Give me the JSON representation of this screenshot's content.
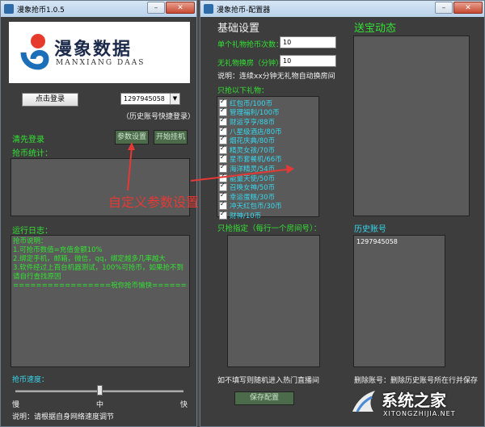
{
  "left": {
    "title": "漫象抢币1.0.5",
    "logo": {
      "brand": "漫象数据",
      "sub": "MANXIANG DAAS"
    },
    "login_button": "点击登录",
    "account_select": "1297945058",
    "history_hint": "（历史账号快捷登录）",
    "login_status": "清先登录",
    "config_button": "参数设置",
    "start_button": "开始挂机",
    "stats_label": "抢币统计：",
    "annotation": "自定义参数设置",
    "log_label": "运行日志：",
    "log_lines": [
      "抢币说明：",
      "1.可抢币数值=充值金额10%",
      "2.绑定手机，邮箱，微信，qq，绑定越多几率越大",
      "3.软件经过上百台机器测试，100%可抢币，如果抢不到请自行查找原因",
      "=================祝你抢币愉快================"
    ],
    "speed_label": "抢币速度：",
    "speed_slow": "慢",
    "speed_mid": "中",
    "speed_fast": "快",
    "speed_value": 0.5,
    "speed_note": "说明：请根据自身网络速度调节"
  },
  "right": {
    "title": "漫象抢币-配置器",
    "basic_title": "基础设置",
    "count_label": "单个礼物抢币次数：",
    "count_value": "10",
    "switch_label": "无礼物换房（分钟）：",
    "switch_value": "10",
    "switch_note": "说明：连续xx分钟无礼物自动换房间",
    "gifts_label": "只抢以下礼物：",
    "gifts": [
      "红包币/100币",
      "管理福利/100币",
      "财运亨亨/88币",
      "八星级酒店/80币",
      "烟花庆典/80币",
      "精灵女孩/70币",
      "星币套餐机/66币",
      "海洋精灵/54币",
      "能量天使/50币",
      "召唤女神/50币",
      "幸运蛋糕/30币",
      "冲天红包币/30币",
      "财神/10币"
    ],
    "rooms_label": "只抢指定（每行一个房间号）：",
    "rooms_note": "如不填写则随机进入热门直播间",
    "save_button": "保存配置",
    "dynamics_title": "送宝动态",
    "history_title": "历史账号",
    "history_items": [
      "1297945058"
    ],
    "history_note": "删除账号：删除历史账号所在行并保存"
  },
  "watermark": {
    "brand": "系统之家",
    "url": "XITONGZHIJIA.NET"
  },
  "colors": {
    "green": "#33e233",
    "cyan": "#37d7ee",
    "red": "#e53935",
    "panel": "#5a5a5a"
  }
}
